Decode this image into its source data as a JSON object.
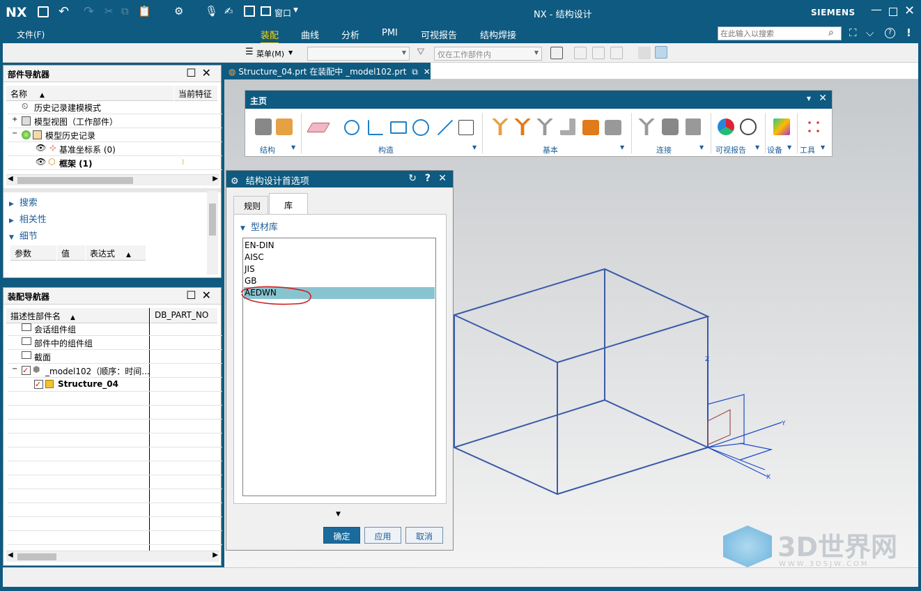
{
  "titlebar": {
    "logo": "NX",
    "window_menu": "窗口",
    "title": "NX - 结构设计",
    "brand": "SIEMENS"
  },
  "menubar": {
    "file_menu": "文件(F)",
    "tabs": [
      "装配",
      "曲线",
      "分析",
      "PMI",
      "可视报告",
      "结构焊接"
    ],
    "active_tab": "装配",
    "search_placeholder": "在此输入以搜索"
  },
  "cmdbar": {
    "menu_label": "菜单(M)",
    "filter_combo": "",
    "scope_combo": "仅在工作部件内"
  },
  "part_navigator": {
    "title": "部件导航器",
    "col_name": "名称",
    "col_feature": "当前特征",
    "items": [
      "历史记录建模模式",
      "模型视图（工作部件）",
      "模型历史记录",
      "基准坐标系 (0)",
      "框架 (1)"
    ],
    "sections": [
      "搜索",
      "相关性",
      "细节"
    ],
    "detail_cols": [
      "参数",
      "值",
      "表达式"
    ]
  },
  "assembly_navigator": {
    "title": "装配导航器",
    "col_name": "描述性部件名",
    "col_part_no": "DB_PART_NO",
    "items": [
      "会话组件组",
      "部件中的组件组",
      "截面",
      "_model102（顺序：时间...",
      "Structure_04"
    ]
  },
  "document_tab": {
    "label": "Structure_04.prt 在装配中 _model102.prt"
  },
  "ribbon": {
    "title": "主页",
    "groups": [
      "结构",
      "构造",
      "基本",
      "连接",
      "可视报告",
      "设备",
      "工具"
    ]
  },
  "dialog": {
    "title": "结构设计首选项",
    "tabs": [
      "规则",
      "库"
    ],
    "active_tab": "库",
    "section": "型材库",
    "libraries": [
      "EN-DIN",
      "AISC",
      "JIS",
      "GB",
      "AEDWN"
    ],
    "selected": "AEDWN",
    "ok": "确定",
    "apply": "应用",
    "cancel": "取消"
  },
  "viewport": {
    "axes": [
      "Z",
      "X",
      "Y"
    ]
  },
  "watermark": {
    "text": "3D世界网",
    "url": "WWW.3DSJW.COM"
  },
  "colors": {
    "accent": "#0e5a80",
    "active_tab": "#ffd200",
    "selection": "#88c4d0",
    "model_edges": "#3a5aa8"
  }
}
